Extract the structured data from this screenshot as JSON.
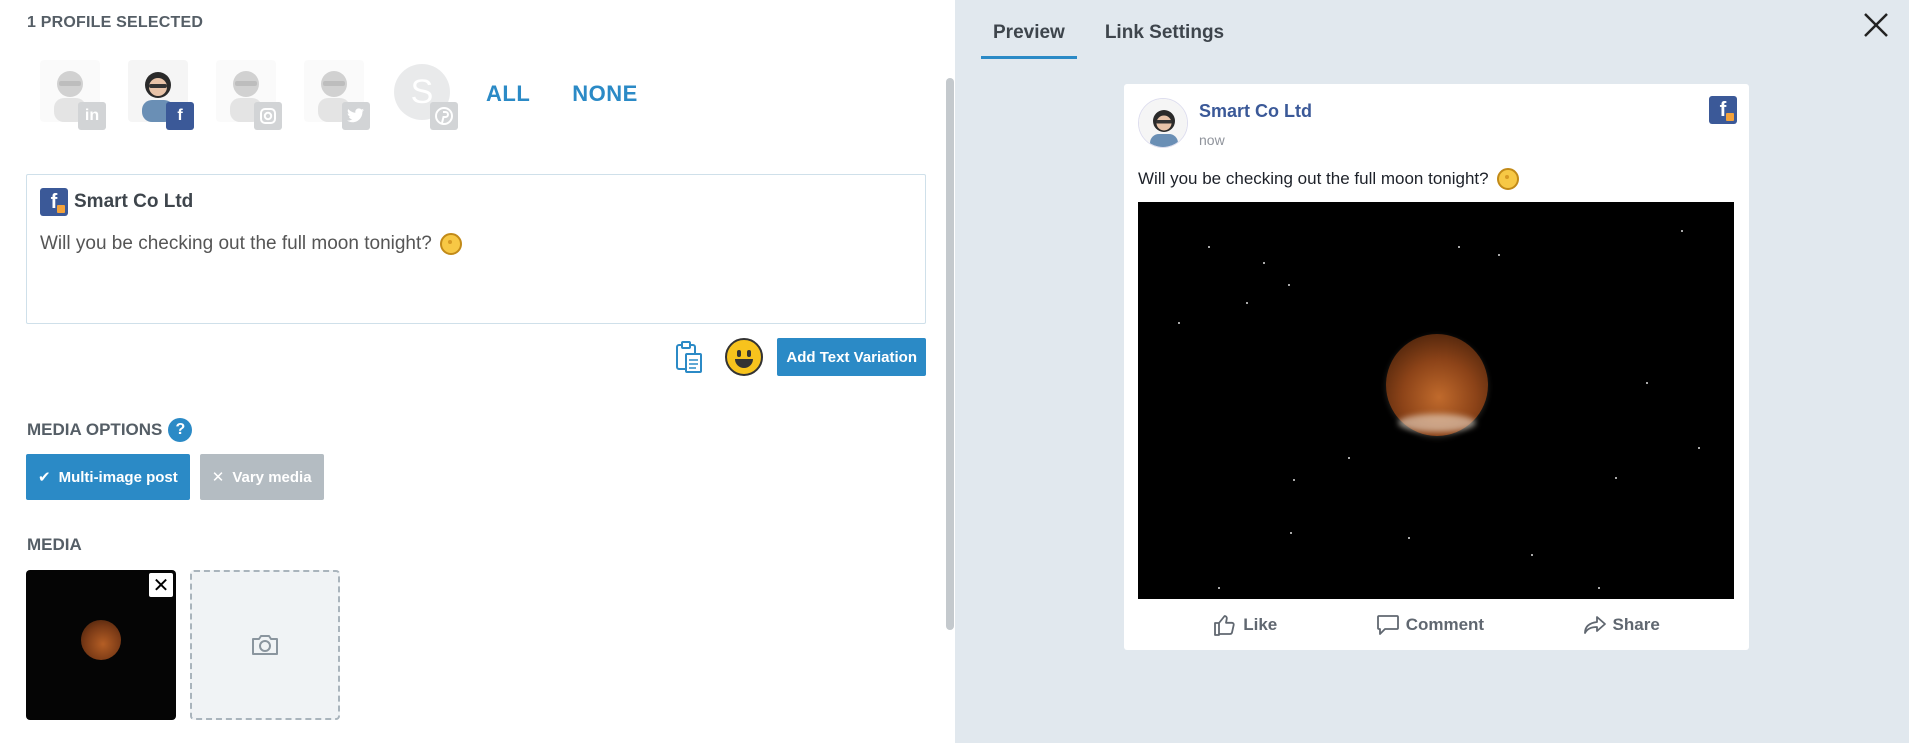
{
  "left": {
    "profile_count": "1 PROFILE SELECTED",
    "select_all": "ALL",
    "select_none": "NONE",
    "profiles": [
      {
        "network": "linkedin",
        "selected": false,
        "icon": "linkedin-icon"
      },
      {
        "network": "facebook",
        "selected": true,
        "icon": "facebook-icon"
      },
      {
        "network": "instagram",
        "selected": false,
        "icon": "instagram-icon"
      },
      {
        "network": "twitter",
        "selected": false,
        "icon": "twitter-icon"
      },
      {
        "network": "pinterest",
        "selected": false,
        "icon": "pinterest-icon",
        "avatar_letter": "S"
      }
    ],
    "composer": {
      "account_name": "Smart Co Ltd",
      "text": "Will you be checking out the full moon tonight?"
    },
    "add_text_variation": "Add Text Variation",
    "media_options_label": "MEDIA OPTIONS",
    "help": "?",
    "options": {
      "multi_image": "Multi-image post",
      "vary_media": "Vary media"
    },
    "media_label": "MEDIA",
    "remove_glyph": "✕"
  },
  "right": {
    "tabs": [
      "Preview",
      "Link Settings"
    ],
    "active_tab": "Preview",
    "preview": {
      "account_name": "Smart Co Ltd",
      "time": "now",
      "text": "Will you be checking out the full moon tonight?",
      "actions": {
        "like": "Like",
        "comment": "Comment",
        "share": "Share"
      }
    }
  },
  "colors": {
    "accent": "#2b8ac6",
    "facebook": "#3b5998",
    "panel_bg": "#e1e8ee",
    "disabled": "#b4bcc2"
  }
}
